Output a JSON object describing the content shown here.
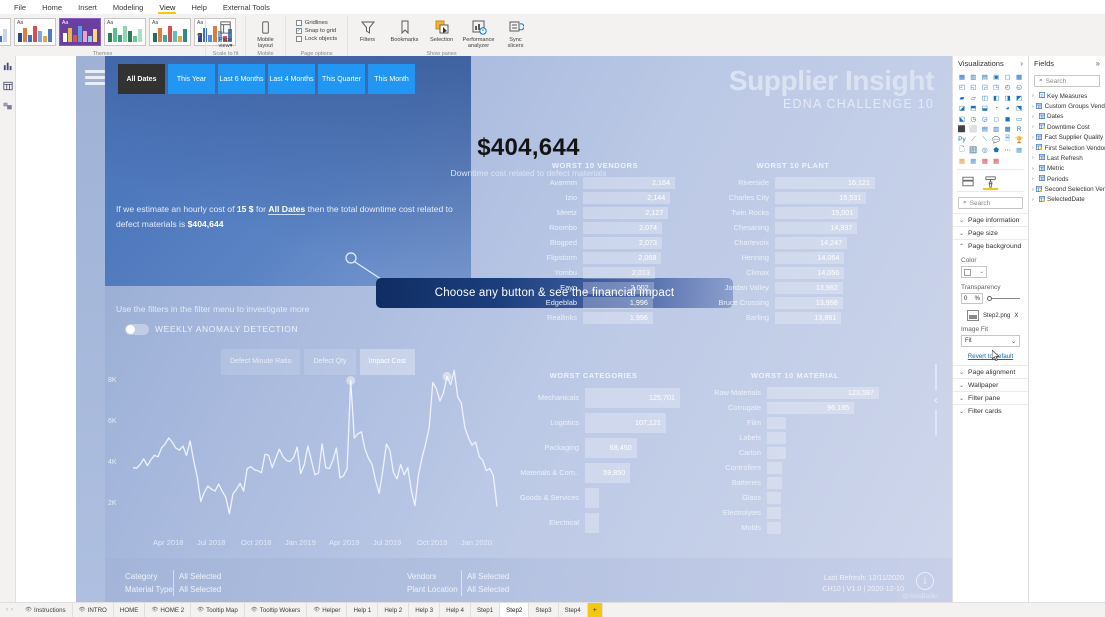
{
  "ribbon": {
    "menus": [
      {
        "label": "File",
        "active": false
      },
      {
        "label": "Home",
        "active": false
      },
      {
        "label": "Insert",
        "active": false
      },
      {
        "label": "Modeling",
        "active": false
      },
      {
        "label": "View",
        "active": true
      },
      {
        "label": "Help",
        "active": false
      },
      {
        "label": "External Tools",
        "active": false
      }
    ],
    "groups": [
      {
        "label": "Themes"
      },
      {
        "label": "Scale to fit"
      },
      {
        "label": "Mobile"
      },
      {
        "label": "Page options"
      },
      {
        "label": "Show panes"
      }
    ],
    "theme_more": "▾",
    "buttons": [
      {
        "name": "page-view",
        "label": "Page\nview",
        "icon": "page-view-icon"
      },
      {
        "name": "mobile-layout",
        "label": "Mobile\nlayout",
        "icon": "mobile-layout-icon"
      },
      {
        "name": "filters",
        "label": "Filters",
        "icon": "funnel-icon"
      },
      {
        "name": "bookmarks",
        "label": "Bookmarks",
        "icon": "bookmark-icon"
      },
      {
        "name": "selection",
        "label": "Selection",
        "icon": "selection-icon"
      },
      {
        "name": "performance-analyzer",
        "label": "Performance\nanalyzer",
        "icon": "performance-icon"
      },
      {
        "name": "sync-slicers",
        "label": "Sync\nslicers",
        "icon": "sync-slicers-icon"
      }
    ],
    "page_view_label_1": "Page",
    "page_view_label_2": "view",
    "mobile_label_1": "Mobile",
    "mobile_label_2": "layout",
    "filters_label": "Filters",
    "bookmarks_label": "Bookmarks",
    "selection_label": "Selection",
    "perf_label_1": "Performance",
    "perf_label_2": "analyzer",
    "sync_label_1": "Sync",
    "sync_label_2": "slicers",
    "checkboxes": [
      {
        "label": "Gridlines",
        "checked": false
      },
      {
        "label": "Snap to grid",
        "checked": true
      },
      {
        "label": "Lock objects",
        "checked": false
      }
    ]
  },
  "report": {
    "title": "Supplier Insight",
    "subtitle": "EDNA CHALLENGE 10",
    "date_buttons": [
      {
        "label": "All Dates",
        "selected": true
      },
      {
        "label": "This Year",
        "selected": false
      },
      {
        "label": "Last 6 Months",
        "selected": false
      },
      {
        "label": "Last 4 Months",
        "selected": false
      },
      {
        "label": "This Quarter",
        "selected": false
      },
      {
        "label": "This Month",
        "selected": false
      }
    ],
    "big_number": "$404,644",
    "big_number_caption": "Downtime cost related to defect materials",
    "paragraph_prefix": "If we estimate an hourly cost of ",
    "paragraph_rate": "15 $",
    "paragraph_mid": " for ",
    "paragraph_range": "All Dates",
    "paragraph_tail": " then the total downtime cost related to defect materials is ",
    "paragraph_total": "$404,644",
    "paragraph_hint": "Use the filters in the filter menu to investigate more",
    "metric_buttons": [
      {
        "label": "Defect Minute Ratio",
        "selected": false
      },
      {
        "label": "Defect Qty",
        "selected": false
      },
      {
        "label": "Impact Cost",
        "selected": true
      }
    ],
    "callout": "Choose any button & see the financial impact",
    "anomaly_title": "WEEKLY ANOMALY DETECTION",
    "footer": {
      "label_category": "Category",
      "value_category": "All Selected",
      "label_material": "Material Type",
      "value_material": "All Selected",
      "label_vendors": "Vendors",
      "value_vendors": "All Selected",
      "label_plant": "Plant Location",
      "value_plant": "All Selected",
      "last_refresh": "Last Refresh: 12/11/2020",
      "version": "CH10 | V1.0 | 2020-12-10",
      "watermark": "@AlexBadiu",
      "info_icon": "i"
    },
    "edge_collapse_icon": "‹"
  },
  "chart_data": [
    {
      "type": "bar",
      "title": "WORST 10 VENDORS",
      "orientation": "horizontal",
      "categories": [
        "Avarmm",
        "Izio",
        "Meetz",
        "Roombo",
        "Blogped",
        "Flipstorm",
        "Yombu",
        "Eayo",
        "Edgeblab",
        "Reallinks"
      ],
      "values": [
        2184,
        2144,
        2127,
        2074,
        2073,
        2068,
        2013,
        2002,
        1996,
        1996
      ],
      "value_labels": [
        "2,184",
        "2,144",
        "2,127",
        "2,074",
        "2,073",
        "2,068",
        "2,013",
        "2,002",
        "1,996",
        "1,996"
      ],
      "xlabel": "",
      "ylabel": "",
      "grid": false,
      "legend": "none"
    },
    {
      "type": "bar",
      "title": "WORST 10 PLANT",
      "orientation": "horizontal",
      "categories": [
        "Riverside",
        "Charles City",
        "Twin Rocks",
        "Chesaning",
        "Charlevoix",
        "Henning",
        "Climax",
        "Jordan Valley",
        "Bruce Crossing",
        "Barling"
      ],
      "values": [
        16121,
        15531,
        15001,
        14937,
        14247,
        14064,
        14056,
        13962,
        13958,
        13861
      ],
      "value_labels": [
        "16,121",
        "15,531",
        "15,001",
        "14,937",
        "14,247",
        "14,064",
        "14,056",
        "13,962",
        "13,958",
        "13,861"
      ],
      "xlabel": "",
      "ylabel": "",
      "grid": false,
      "legend": "none"
    },
    {
      "type": "bar",
      "title": "WORST CATEGORIES",
      "orientation": "horizontal",
      "categories": [
        "Mechanicals",
        "Logistics",
        "Packaging",
        "Materials & Com..",
        "Goods & Services",
        "Electrical"
      ],
      "values": [
        125701,
        107121,
        68450,
        59850,
        18000,
        8000
      ],
      "value_labels": [
        "125,701",
        "107,121",
        "68,450",
        "59,850",
        "",
        ""
      ],
      "xlabel": "",
      "ylabel": "",
      "grid": false,
      "legend": "none"
    },
    {
      "type": "bar",
      "title": "WORST 10 MATERIAL",
      "orientation": "horizontal",
      "categories": [
        "Raw Materials",
        "Corrugate",
        "Film",
        "Labels",
        "Carton",
        "Controllers",
        "Batteries",
        "Glass",
        "Electrolytes",
        "Molds"
      ],
      "values": [
        123597,
        96195,
        21000,
        21000,
        21000,
        17000,
        17000,
        16000,
        16000,
        15000
      ],
      "value_labels": [
        "123,597",
        "96,195",
        "",
        "",
        "",
        "",
        "",
        "",
        "",
        ""
      ],
      "xlabel": "",
      "ylabel": "",
      "grid": false,
      "legend": "none"
    },
    {
      "type": "line",
      "title": "WEEKLY ANOMALY DETECTION",
      "xlabel": "",
      "ylabel": "",
      "ytick_labels": [
        "8K",
        "6K",
        "4K",
        "2K"
      ],
      "ytick_values": [
        8000,
        6000,
        4000,
        2000
      ],
      "ylim": [
        1000,
        9000
      ],
      "xtick_labels": [
        "Apr 2018",
        "Jul 2018",
        "Oct 2018",
        "Jan 2019",
        "Apr 2019",
        "Jul 2019",
        "Oct 2019",
        "Jan 2020"
      ],
      "grid": false,
      "legend": "none",
      "anomaly_points": 2,
      "values": [
        3750,
        3720,
        3900,
        4180,
        3850,
        4120,
        4350,
        4280,
        4700,
        4900,
        5200,
        4980,
        4700,
        4600,
        4800,
        4350,
        5050,
        4100,
        3300,
        2100,
        2550,
        2850,
        2700,
        2600,
        2950,
        2600,
        2300,
        1500,
        2450,
        2700,
        2980,
        2600,
        3700,
        3800,
        3650,
        3600,
        3500,
        4400,
        4350,
        3750,
        4200,
        4650,
        4300,
        4100,
        4050,
        4250,
        4750,
        3450,
        3900,
        4800,
        4100,
        3400,
        3500,
        4900,
        3750,
        3700,
        4100,
        4700,
        3250,
        3350,
        3700,
        8000,
        5200,
        5400,
        5500,
        4650,
        4200,
        3900,
        3100,
        2500,
        3600,
        4900,
        4600,
        3500,
        3200,
        3900,
        3400,
        3750,
        2600,
        1900,
        3400,
        4250,
        4900,
        5700,
        7900,
        7600,
        7000,
        7400,
        8200,
        7800,
        8500,
        7200,
        6900,
        5700,
        5200,
        4850,
        5000,
        4300,
        4100,
        3600,
        3700,
        3350,
        1850
      ]
    }
  ],
  "visualizations": {
    "title": "Visualizations",
    "collapse_icon": "›",
    "tabs": [
      {
        "name": "fields-tab",
        "icon": "fields-bucket-icon",
        "active": false
      },
      {
        "name": "format-tab",
        "icon": "paint-roller-icon",
        "active": true
      }
    ],
    "search_placeholder": "Search",
    "sections": [
      {
        "label": "Page information",
        "expanded": false
      },
      {
        "label": "Page size",
        "expanded": false
      },
      {
        "label": "Page background",
        "expanded": true
      },
      {
        "label": "Page alignment",
        "expanded": false
      },
      {
        "label": "Wallpaper",
        "expanded": false
      },
      {
        "label": "Filter pane",
        "expanded": false
      },
      {
        "label": "Filter cards",
        "expanded": false
      }
    ],
    "page_background": {
      "color_label": "Color",
      "color_value": "#FFFFFF",
      "transparency_label": "Transparency",
      "transparency_value": "0",
      "transparency_unit": "%",
      "image_name": "Step2.png",
      "image_remove": "X",
      "image_fit_label": "Image Fit",
      "image_fit_value": "Fit",
      "revert_label": "Revert to default"
    }
  },
  "fields": {
    "title": "Fields",
    "collapse_icon": "»",
    "search_placeholder": "Search",
    "items": [
      {
        "label": "Key Measures",
        "icon": "measures-icon"
      },
      {
        "label": "Custom Groups Vendor",
        "icon": "table-icon"
      },
      {
        "label": "Dates",
        "icon": "table-icon"
      },
      {
        "label": "Downtime Cost",
        "icon": "calc-table-icon"
      },
      {
        "label": "Fact Supplier Quality",
        "icon": "table-icon"
      },
      {
        "label": "First Selection Vendor",
        "icon": "calc-table-icon"
      },
      {
        "label": "Last Refresh",
        "icon": "table-icon"
      },
      {
        "label": "Metric",
        "icon": "table-icon"
      },
      {
        "label": "Periods",
        "icon": "table-icon"
      },
      {
        "label": "Second Selection Vendor",
        "icon": "calc-table-icon"
      },
      {
        "label": "SelectedDate",
        "icon": "calc-table-icon"
      }
    ]
  },
  "page_tabs": {
    "prev_icon": "‹",
    "next_icon": "›",
    "add_icon": "+",
    "tabs": [
      {
        "label": "Instructions",
        "hidden": true,
        "active": false
      },
      {
        "label": "INTRO",
        "hidden": true,
        "active": false
      },
      {
        "label": "HOME",
        "hidden": false,
        "active": false
      },
      {
        "label": "HOME 2",
        "hidden": true,
        "active": false
      },
      {
        "label": "Tooltip Map",
        "hidden": true,
        "active": false
      },
      {
        "label": "Tooltip Wokers",
        "hidden": true,
        "active": false
      },
      {
        "label": "Helper",
        "hidden": true,
        "active": false
      },
      {
        "label": "Help 1",
        "hidden": false,
        "active": false
      },
      {
        "label": "Help 2",
        "hidden": false,
        "active": false
      },
      {
        "label": "Help 3",
        "hidden": false,
        "active": false
      },
      {
        "label": "Help 4",
        "hidden": false,
        "active": false
      },
      {
        "label": "Step1",
        "hidden": false,
        "active": false
      },
      {
        "label": "Step2",
        "hidden": false,
        "active": true
      },
      {
        "label": "Step3",
        "hidden": false,
        "active": false
      },
      {
        "label": "Step4",
        "hidden": false,
        "active": false
      }
    ]
  },
  "left_rail": [
    {
      "name": "report-view-icon"
    },
    {
      "name": "data-view-icon"
    },
    {
      "name": "model-view-icon"
    }
  ],
  "colors": {
    "accent_yellow": "#f2c811",
    "button_blue": "#2196f3",
    "selected_dark": "#323232",
    "callout_navy": "#102d63"
  }
}
